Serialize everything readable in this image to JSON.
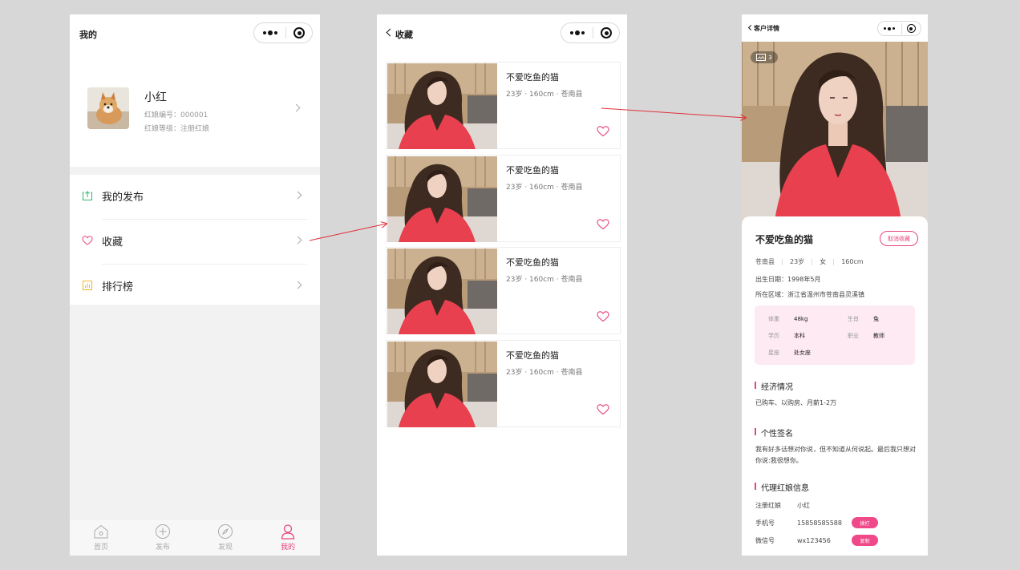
{
  "colors": {
    "accent": "#e8457a",
    "background": "#d7d7d7",
    "arrow": "#e0303a"
  },
  "screen1": {
    "title": "我的",
    "profile": {
      "name": "小红",
      "id_line": "红娘编号：000001",
      "level_line": "红娘等级：注册红娘"
    },
    "menu": [
      {
        "label": "我的发布",
        "icon": "upload-icon"
      },
      {
        "label": "收藏",
        "icon": "heart-icon"
      },
      {
        "label": "排行榜",
        "icon": "chart-icon"
      }
    ],
    "tabs": [
      {
        "label": "首页",
        "icon": "home-icon"
      },
      {
        "label": "发布",
        "icon": "plus-circle-icon"
      },
      {
        "label": "发现",
        "icon": "compass-icon"
      },
      {
        "label": "我的",
        "icon": "user-icon",
        "active": true
      }
    ]
  },
  "screen2": {
    "title": "收藏",
    "cards": [
      {
        "name": "不爱吃鱼的猫",
        "meta": "23岁 · 160cm · 苍南县"
      },
      {
        "name": "不爱吃鱼的猫",
        "meta": "23岁 · 160cm · 苍南县"
      },
      {
        "name": "不爱吃鱼的猫",
        "meta": "23岁 · 160cm · 苍南县"
      },
      {
        "name": "不爱吃鱼的猫",
        "meta": "23岁 · 160cm · 苍南县"
      }
    ]
  },
  "screen3": {
    "title": "客户详情",
    "photo_count": "3",
    "name": "不爱吃鱼的猫",
    "unfavorite": "取消收藏",
    "tags": [
      "苍南县",
      "23岁",
      "女",
      "160cm"
    ],
    "birth": "出生日期：1998年5月",
    "region": "所在区域：浙江省温州市苍南县灵溪镇",
    "attrs": {
      "weight_k": "体重",
      "weight_v": "48kg",
      "zodiac_k": "生肖",
      "zodiac_v": "兔",
      "edu_k": "学历",
      "edu_v": "本科",
      "job_k": "职业",
      "job_v": "教师",
      "star_k": "星座",
      "star_v": "处女座"
    },
    "econ_title": "经济情况",
    "econ_text": "已购车、以购房、月薪1-2万",
    "sign_title": "个性签名",
    "sign_text": "我有好多话想对你说，但不知道从何说起。最后我只想对你说:我很想你。",
    "agent_title": "代理红娘信息",
    "agent": {
      "reg_k": "注册红娘",
      "reg_v": "小红",
      "phone_k": "手机号",
      "phone_v": "15858585588",
      "call": "拨打",
      "wx_k": "微信号",
      "wx_v": "wx123456",
      "copy": "复制"
    }
  }
}
